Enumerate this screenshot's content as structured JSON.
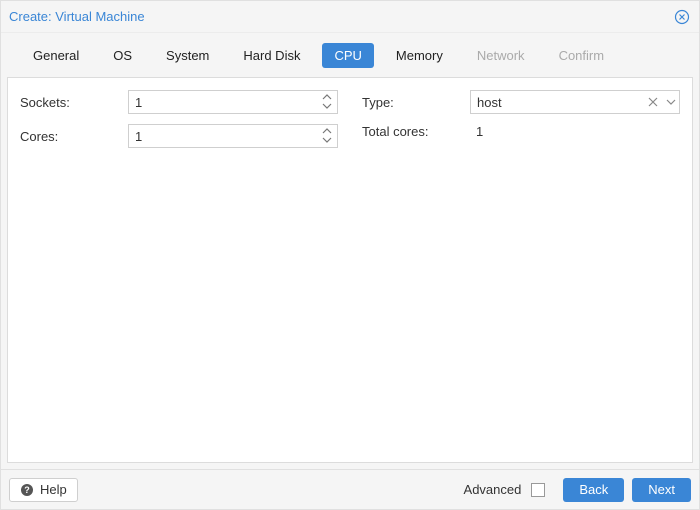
{
  "window": {
    "title": "Create: Virtual Machine"
  },
  "tabs": {
    "general": "General",
    "os": "OS",
    "system": "System",
    "hard_disk": "Hard Disk",
    "cpu": "CPU",
    "memory": "Memory",
    "network": "Network",
    "confirm": "Confirm",
    "active": "cpu"
  },
  "fields": {
    "sockets": {
      "label": "Sockets:",
      "value": "1"
    },
    "cores": {
      "label": "Cores:",
      "value": "1"
    },
    "type": {
      "label": "Type:",
      "value": "host"
    },
    "total_cores": {
      "label": "Total cores:",
      "value": "1"
    }
  },
  "footer": {
    "help": "Help",
    "advanced": "Advanced",
    "advanced_checked": false,
    "back": "Back",
    "next": "Next"
  }
}
